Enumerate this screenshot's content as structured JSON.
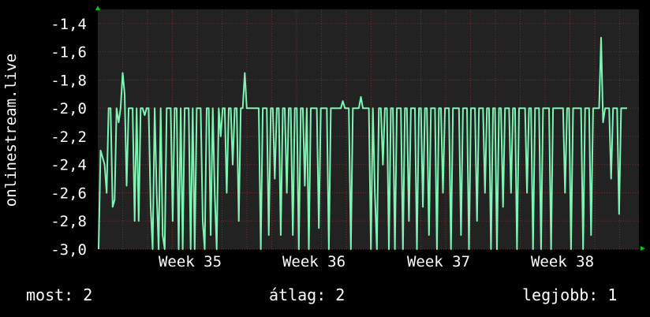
{
  "chart_data": {
    "type": "line",
    "ylabel": "onlinestream.live",
    "ylim": [
      -3.0,
      -1.3
    ],
    "y_ticks": [
      "-1,4",
      "-1,6",
      "-1,8",
      "-2,0",
      "-2,2",
      "-2,4",
      "-2,6",
      "-2,8",
      "-3,0"
    ],
    "y_tick_values": [
      -1.4,
      -1.6,
      -1.8,
      -2.0,
      -2.2,
      -2.4,
      -2.6,
      -2.8,
      -3.0
    ],
    "x_ticks": [
      "Week 35",
      "Week 36",
      "Week 37",
      "Week 38"
    ],
    "grid": true,
    "colors": {
      "background": "#000000",
      "plot_background": "#222222",
      "line": "#7df5b4",
      "grid": "#7a2a2a",
      "axis_arrow": "#00cc00",
      "text": "#ffffff"
    },
    "series": [
      {
        "values": [
          -3.0,
          -2.3,
          -2.35,
          -2.4,
          -2.6,
          -2.0,
          -2.0,
          -2.7,
          -2.65,
          -2.0,
          -2.1,
          -2.0,
          -1.75,
          -1.9,
          -2.55,
          -2.0,
          -2.0,
          -2.0,
          -2.8,
          -2.0,
          -2.8,
          -2.0,
          -2.0,
          -2.05,
          -2.0,
          -2.0,
          -2.7,
          -3.0,
          -2.0,
          -2.6,
          -3.0,
          -2.0,
          -2.9,
          -3.0,
          -2.0,
          -2.0,
          -2.0,
          -2.8,
          -2.0,
          -2.0,
          -3.0,
          -2.0,
          -3.0,
          -2.0,
          -2.0,
          -2.0,
          -3.0,
          -2.0,
          -3.0,
          -2.0,
          -2.0,
          -2.0,
          -2.8,
          -3.0,
          -2.0,
          -2.0,
          -2.9,
          -2.0,
          -2.6,
          -3.0,
          -2.0,
          -2.2,
          -2.0,
          -2.0,
          -2.6,
          -2.0,
          -2.0,
          -2.4,
          -2.0,
          -2.0,
          -2.8,
          -2.0,
          -2.0,
          -1.75,
          -2.0,
          -2.0,
          -2.0,
          -2.0,
          -2.0,
          -2.0,
          -2.0,
          -3.0,
          -2.0,
          -2.0,
          -2.0,
          -2.9,
          -2.0,
          -2.0,
          -2.5,
          -2.0,
          -2.0,
          -2.9,
          -2.0,
          -2.0,
          -2.6,
          -2.0,
          -2.0,
          -2.9,
          -2.0,
          -2.0,
          -3.0,
          -2.0,
          -2.0,
          -2.55,
          -2.0,
          -3.0,
          -2.0,
          -2.0,
          -2.0,
          -2.0,
          -2.85,
          -2.0,
          -2.0,
          -2.0,
          -2.0,
          -3.0,
          -2.0,
          -2.0,
          -2.0,
          -2.0,
          -2.0,
          -2.0,
          -1.95,
          -2.0,
          -2.0,
          -2.0,
          -3.0,
          -2.0,
          -2.0,
          -2.0,
          -2.0,
          -1.92,
          -2.0,
          -2.0,
          -2.0,
          -2.0,
          -3.0,
          -2.0,
          -2.6,
          -3.0,
          -2.0,
          -2.0,
          -2.4,
          -2.0,
          -2.0,
          -3.0,
          -2.0,
          -2.0,
          -3.0,
          -2.0,
          -2.0,
          -2.0,
          -3.0,
          -2.0,
          -2.0,
          -2.8,
          -2.0,
          -2.0,
          -2.0,
          -3.0,
          -2.0,
          -2.0,
          -2.7,
          -2.0,
          -2.0,
          -2.9,
          -2.0,
          -2.0,
          -2.0,
          -3.0,
          -2.0,
          -2.0,
          -2.6,
          -2.0,
          -2.0,
          -2.0,
          -3.0,
          -2.0,
          -2.0,
          -2.0,
          -2.0,
          -2.9,
          -2.0,
          -2.0,
          -2.0,
          -3.0,
          -2.0,
          -2.0,
          -2.0,
          -2.8,
          -2.0,
          -2.0,
          -2.0,
          -2.6,
          -2.0,
          -2.0,
          -3.0,
          -2.0,
          -2.0,
          -3.0,
          -2.0,
          -2.0,
          -2.7,
          -2.0,
          -2.0,
          -2.0,
          -2.6,
          -2.0,
          -2.0,
          -3.0,
          -2.0,
          -2.0,
          -2.0,
          -2.0,
          -2.6,
          -2.0,
          -2.0,
          -3.0,
          -2.0,
          -2.0,
          -2.0,
          -3.0,
          -2.0,
          -2.0,
          -2.0,
          -2.0,
          -3.0,
          -2.0,
          -2.0,
          -2.0,
          -2.0,
          -2.0,
          -2.0,
          -2.6,
          -2.0,
          -2.0,
          -3.0,
          -2.0,
          -2.0,
          -2.0,
          -2.0,
          -2.0,
          -3.0,
          -2.0,
          -2.0,
          -2.0,
          -2.9,
          -2.0,
          -2.0,
          -2.0,
          -2.0,
          -1.5,
          -2.1,
          -2.0,
          -2.0,
          -2.0,
          -2.5,
          -2.0,
          -2.0,
          -2.0,
          -2.75,
          -2.0,
          -2.0,
          -2.0,
          -2.0
        ]
      }
    ]
  },
  "footer": {
    "current": "most: 2",
    "average": "átlag: 2",
    "best": "legjobb: 1"
  }
}
